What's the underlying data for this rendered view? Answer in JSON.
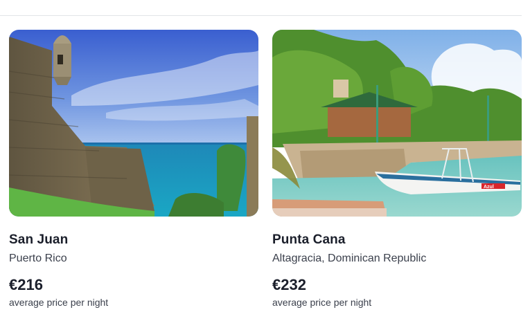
{
  "destinations": [
    {
      "city": "San Juan",
      "country": "Puerto Rico",
      "price": "€216",
      "price_note": "average price per night",
      "image": "san-juan-fort-photo"
    },
    {
      "city": "Punta Cana",
      "country": "Altagracia, Dominican Republic",
      "price": "€232",
      "price_note": "average price per night",
      "image": "punta-cana-marina-photo",
      "boat_text": "Azul"
    }
  ]
}
